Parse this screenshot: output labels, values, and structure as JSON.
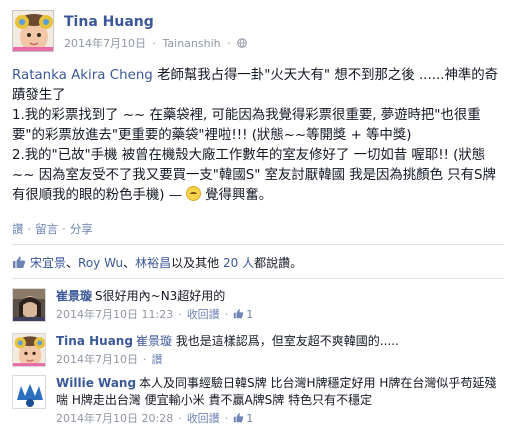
{
  "post": {
    "author": "Tina Huang",
    "date": "2014年7月10日",
    "separator": "·",
    "location": "Tainanshih",
    "text": {
      "mention": "Ratanka Akira Cheng",
      "line1_rest": " 老師幫我占得一卦\"火天大有\" 想不到那之後 ......神準的奇蹟發生了",
      "line2": "1.我的彩票找到了 ~~ 在藥袋裡, 可能因為我覺得彩票很重要, 夢遊時把\"也很重要\"的彩票放進去\"更重要的藥袋\"裡啦!!! (狀態~~等開獎 + 等中獎)",
      "line3_pre": "2.我的\"已故\"手機 被曾在機殼大廠工作數年的室友修好了 一切如昔 喔耶!! (狀態 ~~ 因為室友受不了我又要買一支\"韓國S\" 室友討厭韓國 我是因為挑顏色 只有S牌有很順我的眼的粉色手機) —",
      "feeling": "覺得興奮。"
    },
    "actions": {
      "like": "讚",
      "comment": "留言",
      "share": "分享",
      "dot": "·"
    }
  },
  "likes": {
    "name1": "宋宜景",
    "sep1": "、",
    "name2": "Roy Wu",
    "sep2": "、",
    "name3": "林裕昌",
    "mid": "以及其他",
    "others": "20 人",
    "tail": "都說讚。"
  },
  "comments": [
    {
      "name": "崔景璇",
      "text": "S很好用內~N3超好用的",
      "time": "2014年7月10日 11:23",
      "reply": "收回讚",
      "likes": "1",
      "dot": "·"
    },
    {
      "name": "Tina Huang",
      "tag": "崔景璇",
      "text": " 我也是這樣認爲，但室友超不爽韓國的.....",
      "time": "2014年7月10日",
      "reply": "讚",
      "dot": "·"
    },
    {
      "name": "Willie Wang",
      "text": "本人及同事經驗日韓S牌 比台灣H牌穩定好用 H牌在台灣似乎苟延殘喘 H牌走出台灣 便宜輸小米 貴不贏A牌S牌 特色只有不穩定",
      "time": "2014年7月10日 20:28",
      "reply": "收回讚",
      "likes": "1",
      "dot": "·"
    }
  ],
  "icons": {
    "globe": "globe-icon",
    "like": "thumbs-up-icon",
    "feeling": "smiley-emoticon-icon"
  },
  "colors": {
    "link": "#3b5998",
    "meta": "#9197a3",
    "action": "#6d84b4",
    "text": "#141823"
  }
}
